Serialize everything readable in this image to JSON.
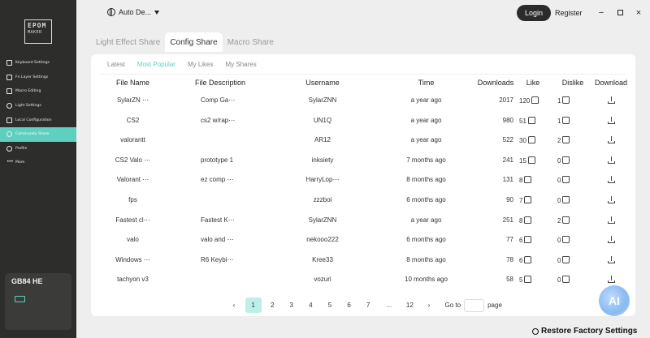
{
  "sidebar": {
    "logo_top": "EPOM",
    "logo_bottom": "MAKER",
    "items": [
      {
        "label": "Keyboard Settings"
      },
      {
        "label": "Fn Layer Settings"
      },
      {
        "label": "Macro Editing"
      },
      {
        "label": "Light Settings"
      },
      {
        "label": "Local Configuration"
      },
      {
        "label": "Community Share"
      },
      {
        "label": "Profile"
      },
      {
        "label": "More"
      }
    ],
    "device_name": "GB84 HE"
  },
  "header": {
    "language": "Auto De...",
    "login": "Login",
    "register": "Register",
    "minimize": "−",
    "close": "×"
  },
  "tabs": [
    "Light Effect Share",
    "Config Share",
    "Macro Share"
  ],
  "subtabs": [
    "Latest",
    "Most Popular",
    "My Likes",
    "My Shares"
  ],
  "columns": [
    "File Name",
    "File Description",
    "Username",
    "Time",
    "Downloads",
    "Like",
    "Dislike",
    "Download"
  ],
  "rows": [
    {
      "file": "SylarZN ⋯",
      "desc": "Comp Ga⋯",
      "user": "SylarZNN",
      "time": "a year ago",
      "downloads": "2017",
      "likes": "120",
      "dislikes": "1"
    },
    {
      "file": "CS2",
      "desc": "cs2 w/rap⋯",
      "user": "UN1Q",
      "time": "a year ago",
      "downloads": "980",
      "likes": "51",
      "dislikes": "1"
    },
    {
      "file": "valorantt",
      "desc": "",
      "user": "AR12",
      "time": "a year ago",
      "downloads": "522",
      "likes": "30",
      "dislikes": "2"
    },
    {
      "file": "CS2 Valo ⋯",
      "desc": "prototype 1",
      "user": "inksiety",
      "time": "7 months ago",
      "downloads": "241",
      "likes": "15",
      "dislikes": "0"
    },
    {
      "file": "Valorant ⋯",
      "desc": "ez comp ⋯",
      "user": "HarryLop⋯",
      "time": "8 months ago",
      "downloads": "131",
      "likes": "8",
      "dislikes": "0"
    },
    {
      "file": "fps",
      "desc": "",
      "user": "zzzboi",
      "time": "6 months ago",
      "downloads": "90",
      "likes": "7",
      "dislikes": "0"
    },
    {
      "file": "Fastest cl⋯",
      "desc": "Fastest K⋯",
      "user": "SylarZNN",
      "time": "a year ago",
      "downloads": "251",
      "likes": "8",
      "dislikes": "2"
    },
    {
      "file": "valo",
      "desc": "valo and ⋯",
      "user": "nekooo222",
      "time": "6 months ago",
      "downloads": "77",
      "likes": "6",
      "dislikes": "0"
    },
    {
      "file": "Windows ⋯",
      "desc": "R6 Keybi⋯",
      "user": "Kree33",
      "time": "8 months ago",
      "downloads": "78",
      "likes": "6",
      "dislikes": "0"
    },
    {
      "file": "tachyon v3",
      "desc": "",
      "user": "vozuri",
      "time": "10 months ago",
      "downloads": "58",
      "likes": "5",
      "dislikes": "0"
    }
  ],
  "pagination": {
    "prev": "‹",
    "pages": [
      "1",
      "2",
      "3",
      "4",
      "5",
      "6",
      "7"
    ],
    "ellipsis": "...",
    "last": "12",
    "next": "›",
    "goto_label": "Go to",
    "page_label": "page"
  },
  "restore": "Restore Factory Settings",
  "watermark": "AI",
  "colors": {
    "accent": "#5fcfbf",
    "sidebar": "#2d2d2b"
  }
}
